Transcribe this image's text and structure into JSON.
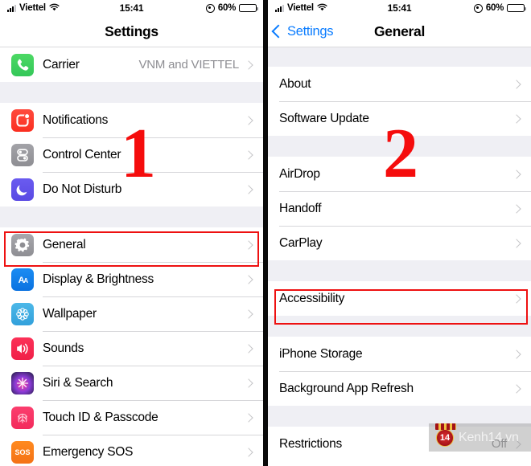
{
  "left": {
    "statusbar": {
      "carrier": "Viettel",
      "wifi_icon": "wifi-icon",
      "time": "15:41",
      "location_icon": "location-services-icon",
      "battery_pct": "60%",
      "battery_level": 60
    },
    "nav": {
      "title": "Settings"
    },
    "groups": [
      {
        "rows": [
          {
            "icon": "phone-icon",
            "icon_class": "ic-phone",
            "label": "Carrier",
            "value": "VNM and VIETTEL"
          }
        ]
      },
      {
        "rows": [
          {
            "icon": "notifications-icon",
            "icon_class": "ic-notif",
            "label": "Notifications",
            "value": ""
          },
          {
            "icon": "control-center-icon",
            "icon_class": "ic-cc",
            "label": "Control Center",
            "value": ""
          },
          {
            "icon": "do-not-disturb-icon",
            "icon_class": "ic-dnd",
            "label": "Do Not Disturb",
            "value": ""
          }
        ]
      },
      {
        "rows": [
          {
            "icon": "gear-icon",
            "icon_class": "ic-general",
            "label": "General",
            "value": ""
          },
          {
            "icon": "display-brightness-icon",
            "icon_class": "ic-display",
            "label": "Display & Brightness",
            "value": ""
          },
          {
            "icon": "wallpaper-icon",
            "icon_class": "ic-wallpaper",
            "label": "Wallpaper",
            "value": ""
          },
          {
            "icon": "speaker-icon",
            "icon_class": "ic-sounds",
            "label": "Sounds",
            "value": ""
          },
          {
            "icon": "siri-icon",
            "icon_class": "ic-siri",
            "label": "Siri & Search",
            "value": ""
          },
          {
            "icon": "fingerprint-icon",
            "icon_class": "ic-touchid",
            "label": "Touch ID & Passcode",
            "value": ""
          },
          {
            "icon": "sos-icon",
            "icon_class": "ic-sos",
            "label": "Emergency SOS",
            "value": ""
          }
        ]
      }
    ],
    "annotation": {
      "step_number": "1"
    },
    "highlight_target": "General"
  },
  "right": {
    "statusbar": {
      "carrier": "Viettel",
      "wifi_icon": "wifi-icon",
      "time": "15:41",
      "location_icon": "location-services-icon",
      "battery_pct": "60%",
      "battery_level": 60
    },
    "nav": {
      "back_label": "Settings",
      "title": "General"
    },
    "groups": [
      {
        "rows": [
          {
            "label": "About",
            "value": ""
          },
          {
            "label": "Software Update",
            "value": ""
          }
        ]
      },
      {
        "rows": [
          {
            "label": "AirDrop",
            "value": ""
          },
          {
            "label": "Handoff",
            "value": ""
          },
          {
            "label": "CarPlay",
            "value": ""
          }
        ]
      },
      {
        "rows": [
          {
            "label": "Accessibility",
            "value": ""
          }
        ]
      },
      {
        "rows": [
          {
            "label": "iPhone Storage",
            "value": ""
          },
          {
            "label": "Background App Refresh",
            "value": ""
          }
        ]
      },
      {
        "rows": [
          {
            "label": "Restrictions",
            "value": "Off"
          }
        ]
      }
    ],
    "annotation": {
      "step_number": "2"
    },
    "highlight_target": "Accessibility"
  },
  "watermark": {
    "badge_text": "14",
    "text": "Kenh14.vn"
  }
}
